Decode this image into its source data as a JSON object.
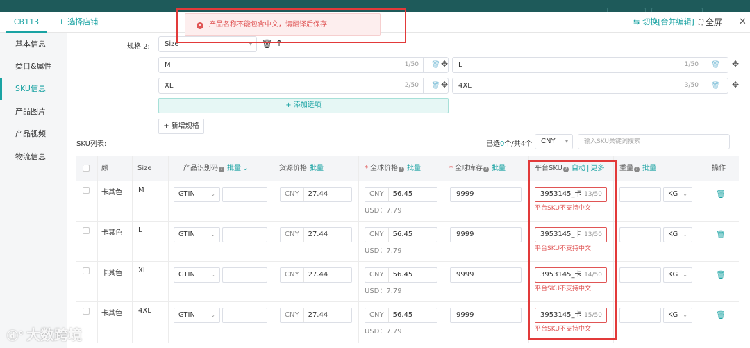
{
  "tabbar": {
    "active_tab": "CB113",
    "select_shop_label": "选择店铺",
    "switch_merge_label": "切换[合并编辑]",
    "fullscreen_label": "全屏"
  },
  "sidebar": {
    "items": [
      {
        "label": "基本信息"
      },
      {
        "label": "类目&属性"
      },
      {
        "label": "SKU信息"
      },
      {
        "label": "产品图片"
      },
      {
        "label": "产品视频"
      },
      {
        "label": "物流信息"
      }
    ],
    "active_index": 2
  },
  "toast": {
    "message": "产品名称不能包含中文，请翻译后保存",
    "color": "#e05555"
  },
  "spec": {
    "label": "规格 2:",
    "selected": "Size",
    "options": [
      {
        "value": "M",
        "count": "1/50"
      },
      {
        "value": "L",
        "count": "1/50"
      },
      {
        "value": "XL",
        "count": "2/50"
      },
      {
        "value": "4XL",
        "count": "3/50"
      }
    ],
    "add_option_label": "添加选项",
    "add_spec_label": "新增规格"
  },
  "sku_list": {
    "label": "SKU列表:",
    "selected_prefix": "已选",
    "selected_count": "0",
    "selected_suffix": "个/共4个",
    "currency": "CNY",
    "search_placeholder": "输入SKU关键词搜索"
  },
  "table": {
    "headers": {
      "color": "颜",
      "size": "Size",
      "product_code": "产品识别码",
      "product_code_batch": "批量",
      "source_price": "货源价格",
      "source_price_batch": "批量",
      "global_price": "全球价格",
      "global_price_batch": "批量",
      "global_stock": "全球库存",
      "global_stock_batch": "批量",
      "platform_sku": "平台SKU",
      "platform_sku_auto": "自动",
      "platform_sku_more": "更多",
      "weight": "重量",
      "weight_batch": "批量",
      "action": "操作"
    },
    "rows": [
      {
        "color": "卡其色",
        "size": "M",
        "code_type": "GTIN",
        "source_currency": "CNY",
        "source_price": "27.44",
        "global_currency": "CNY",
        "global_price": "56.45",
        "usd": "USD：7.79",
        "stock": "9999",
        "sku": "3953145_卡",
        "sku_count": "13/50",
        "sku_error": "平台SKU不支持中文",
        "weight_unit": "KG"
      },
      {
        "color": "卡其色",
        "size": "L",
        "code_type": "GTIN",
        "source_currency": "CNY",
        "source_price": "27.44",
        "global_currency": "CNY",
        "global_price": "56.45",
        "usd": "USD：7.79",
        "stock": "9999",
        "sku": "3953145_卡",
        "sku_count": "13/50",
        "sku_error": "平台SKU不支持中文",
        "weight_unit": "KG"
      },
      {
        "color": "卡其色",
        "size": "XL",
        "code_type": "GTIN",
        "source_currency": "CNY",
        "source_price": "27.44",
        "global_currency": "CNY",
        "global_price": "56.45",
        "usd": "USD：7.79",
        "stock": "9999",
        "sku": "3953145_卡",
        "sku_count": "14/50",
        "sku_error": "平台SKU不支持中文",
        "weight_unit": "KG"
      },
      {
        "color": "卡其色",
        "size": "4XL",
        "code_type": "GTIN",
        "source_currency": "CNY",
        "source_price": "27.44",
        "global_currency": "CNY",
        "global_price": "56.45",
        "usd": "USD：7.79",
        "stock": "9999",
        "sku": "3953145_卡",
        "sku_count": "15/50",
        "sku_error": "平台SKU不支持中文",
        "weight_unit": "KG"
      }
    ]
  },
  "watermark": "大数跨境",
  "colors": {
    "accent": "#1aa3a3",
    "error": "#e05555",
    "highlight": "#e23a3a"
  }
}
